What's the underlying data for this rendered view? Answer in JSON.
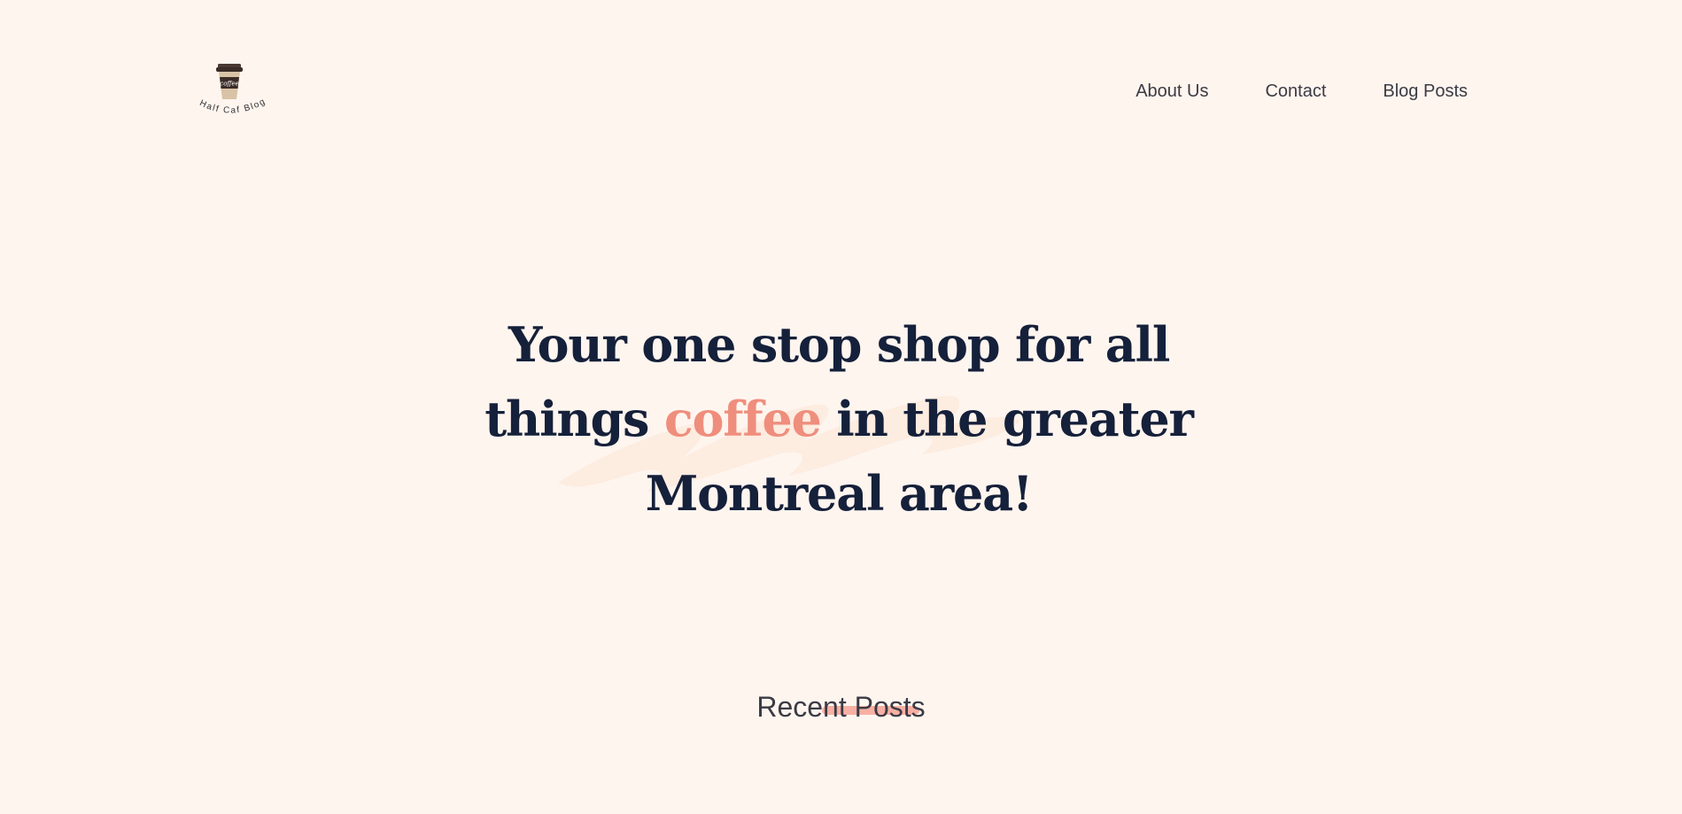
{
  "brand": {
    "logo_cup_text": "coffee",
    "logo_caption": "Half Caf Blog"
  },
  "nav": {
    "items": [
      {
        "label": "About Us"
      },
      {
        "label": "Contact"
      },
      {
        "label": "Blog Posts"
      }
    ]
  },
  "hero": {
    "line1": "Your one stop shop for all",
    "line2_pre": "things ",
    "line2_accent": "coffee",
    "line2_post": " in the greater",
    "line3": "Montreal area!"
  },
  "recent_posts": {
    "title": "Recent Posts"
  },
  "colors": {
    "background": "#fff5ef",
    "heading": "#15203a",
    "accent": "#ef8e7d",
    "nav_text": "#3b3b44"
  }
}
